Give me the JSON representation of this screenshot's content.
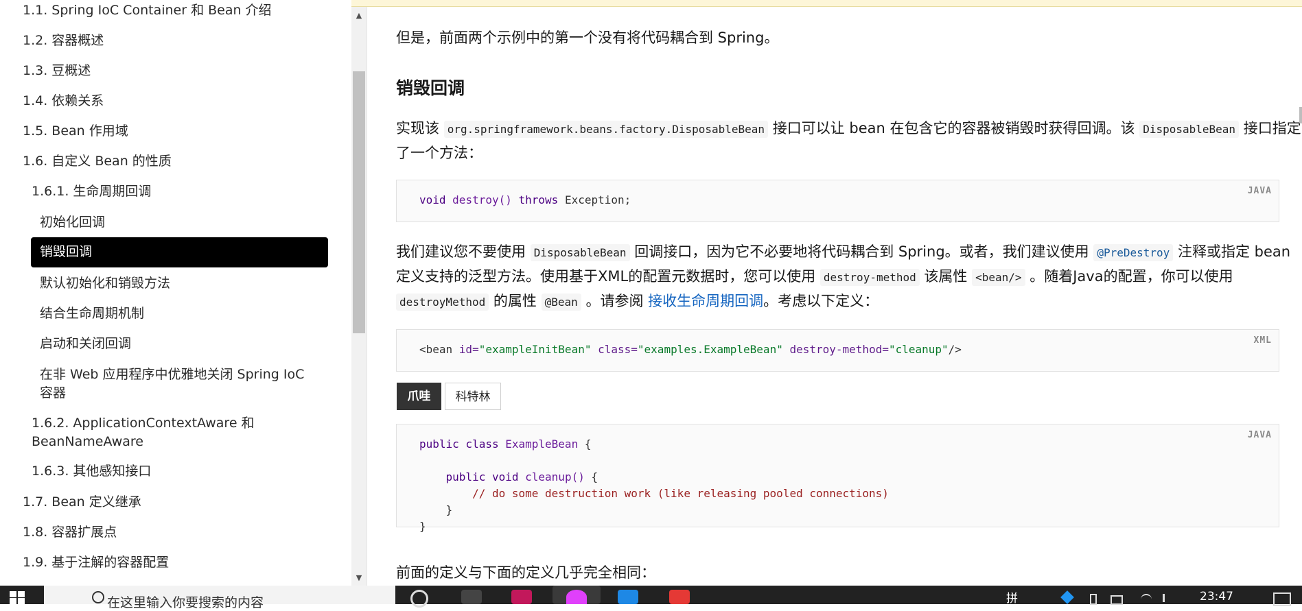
{
  "toc": {
    "items": [
      {
        "label": "1.1. Spring IoC Container 和 Bean 介绍"
      },
      {
        "label": "1.2. 容器概述"
      },
      {
        "label": "1.3. 豆概述"
      },
      {
        "label": "1.4. 依赖关系"
      },
      {
        "label": "1.5. Bean 作用域"
      },
      {
        "label": "1.6. 自定义 Bean 的性质"
      },
      {
        "label": "1.6.1. 生命周期回调"
      },
      {
        "label": "初始化回调"
      },
      {
        "label": "销毁回调"
      },
      {
        "label": "默认初始化和销毁方法"
      },
      {
        "label": "结合生命周期机制"
      },
      {
        "label": "启动和关闭回调"
      },
      {
        "label": "在非 Web 应用程序中优雅地关闭 Spring IoC 容器"
      },
      {
        "label": "1.6.2. ApplicationContextAware 和 BeanNameAware"
      },
      {
        "label": "1.6.3. 其他感知接口"
      },
      {
        "label": "1.7. Bean 定义继承"
      },
      {
        "label": "1.8. 容器扩展点"
      },
      {
        "label": "1.9. 基于注解的容器配置"
      }
    ]
  },
  "main": {
    "intro": "但是，前面两个示例中的第一个没有将代码耦合到 Spring。",
    "heading": "销毁回调",
    "p1": {
      "a": "实现该 ",
      "code1": "org.springframework.beans.factory.DisposableBean",
      "b": " 接口可以让 bean 在包含它的容器被销毁时获得回调。该 ",
      "code2": "DisposableBean",
      "c": " 接口指定了一个方法："
    },
    "code1": {
      "lang": "JAVA",
      "line": {
        "kw1": "void",
        "fn": "destroy()",
        "kw2": "throws",
        "rest": "Exception;"
      }
    },
    "p2": {
      "a": "我们建议您不要使用 ",
      "code1": "DisposableBean",
      "b": " 回调接口，因为它不必要地将代码耦合到 Spring。或者，我们建议使用 ",
      "code2": "@PreDestroy",
      "c": " 注释或指定 bean 定义支持的泛型方法。使用基于XML的配置元数据时，您可以使用 ",
      "code3": "destroy-method",
      "d": " 该属性 ",
      "code4": "<bean/>",
      "e": " 。随着Java的配置，你可以使用 ",
      "code5": "destroyMethod",
      "f": " 的属性 ",
      "code6": "@Bean",
      "g": " 。请参阅 ",
      "link": "接收生命周期回调",
      "h": "。考虑以下定义："
    },
    "code2": {
      "lang": "XML",
      "open": "<bean ",
      "attr1": "id=",
      "val1": "\"exampleInitBean\"",
      "attr2": "class=",
      "val2": "\"examples.ExampleBean\"",
      "attr3": "destroy-method=",
      "val3": "\"cleanup\"",
      "close": "/>"
    },
    "tabs": [
      {
        "label": "爪哇"
      },
      {
        "label": "科特林"
      }
    ],
    "code3": {
      "lang": "JAVA",
      "l1": {
        "kw": "public class",
        "name": "ExampleBean",
        "rest": " {"
      },
      "l2": {
        "kw": "public void",
        "fn": "cleanup()",
        "rest": " {"
      },
      "l3": "// do some destruction work (like releasing pooled connections)",
      "l4": "}",
      "l5": "}"
    },
    "outro": "前面的定义与下面的定义几乎完全相同："
  },
  "taskbar": {
    "search_placeholder": "在这里输入你要搜索的内容",
    "ime": "拼",
    "time": "23:47"
  },
  "colors": {
    "active_bg": "#000000",
    "link": "#1565c0",
    "taskbar": "#222222"
  }
}
